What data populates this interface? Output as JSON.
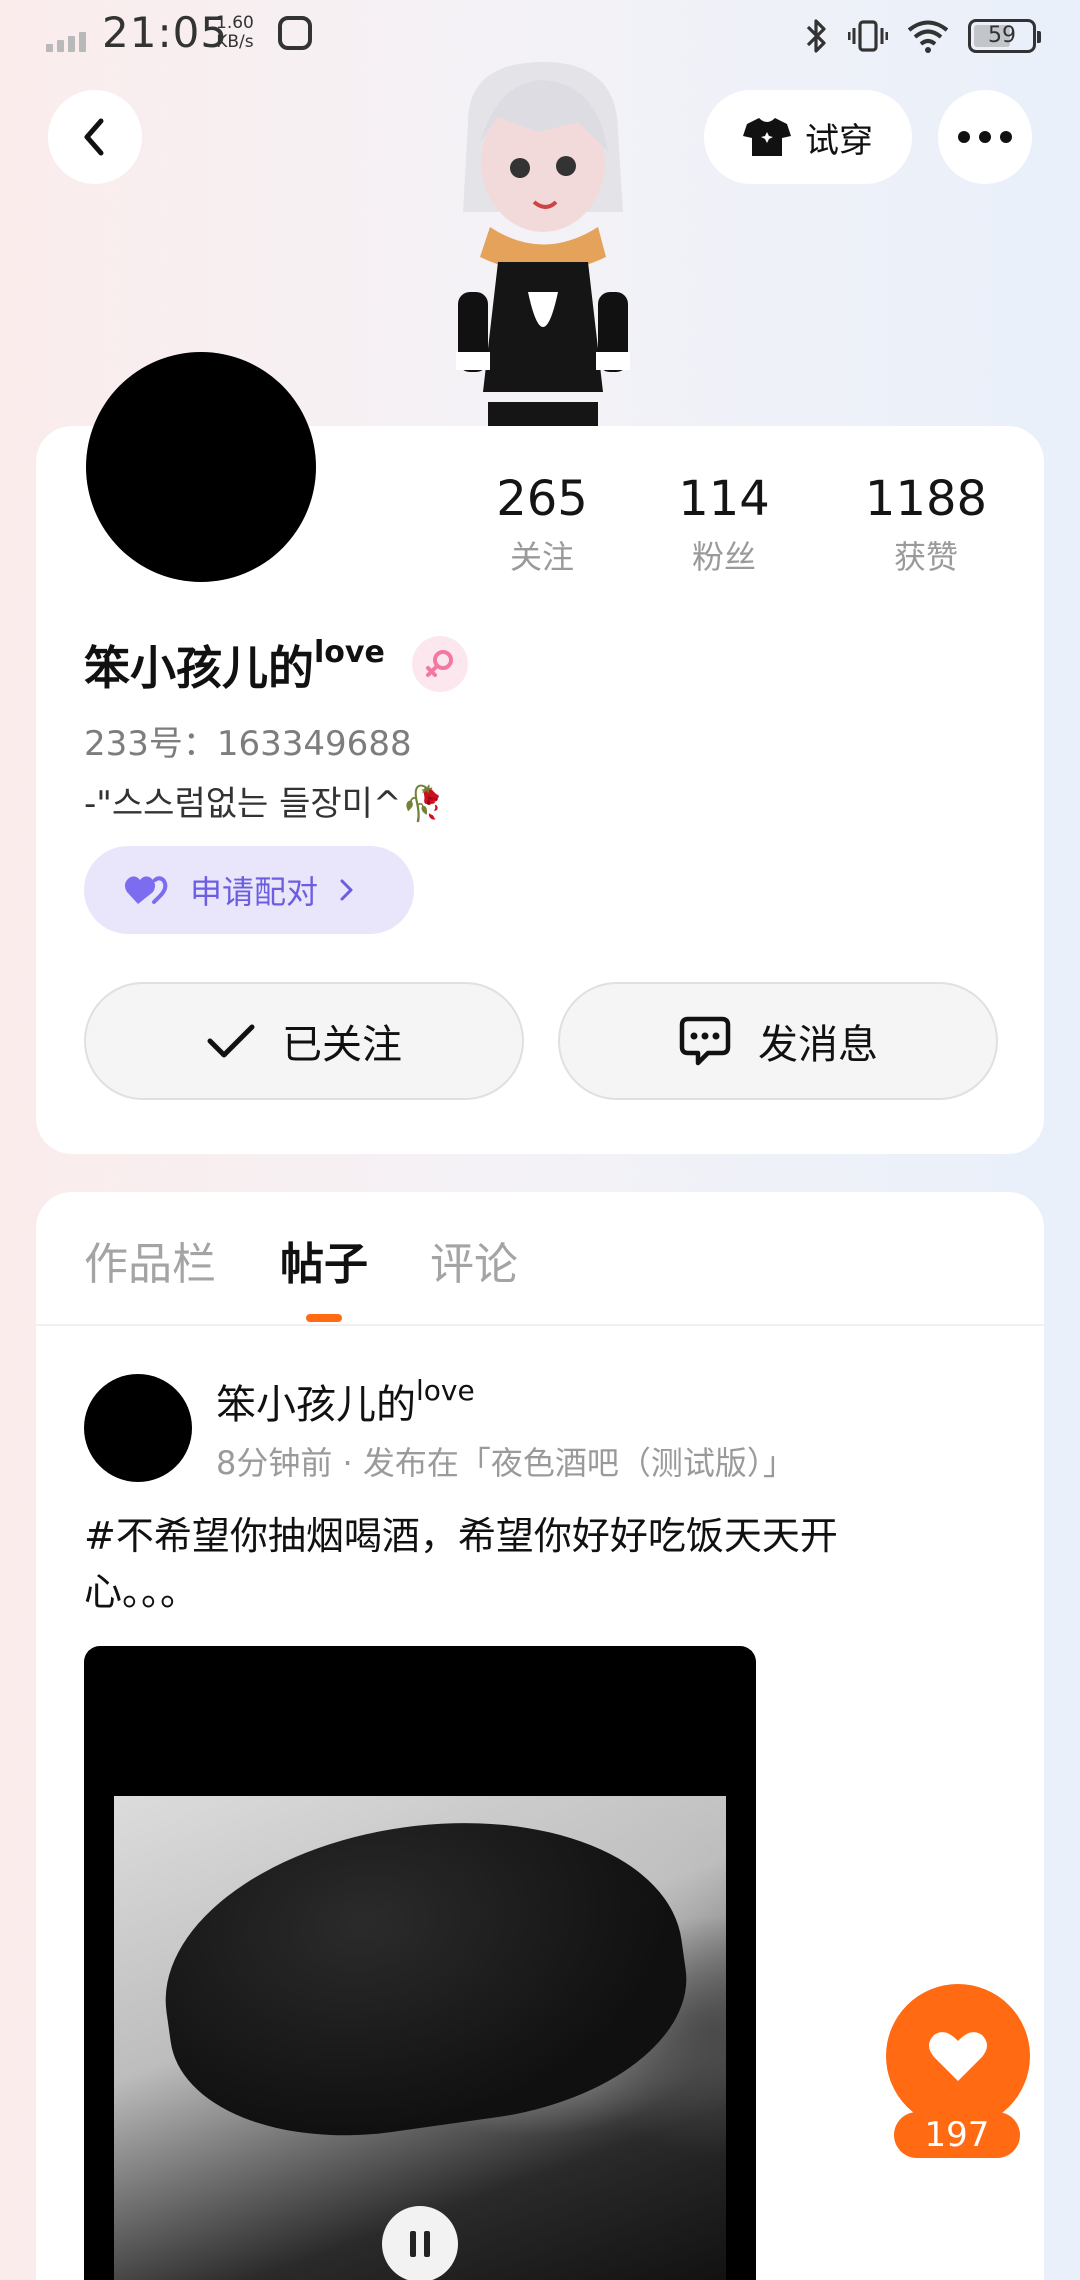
{
  "status_bar": {
    "time": "21:05",
    "net_speed_value": "1.60",
    "net_speed_unit": "KB/s",
    "battery": "59",
    "icons": [
      "signal-icon",
      "camera-app-icon",
      "bluetooth-icon",
      "vibrate-icon",
      "wifi-icon",
      "battery-icon"
    ]
  },
  "top_bar": {
    "try_on_label": "试穿"
  },
  "profile": {
    "stats": [
      {
        "value": "265",
        "label": "关注"
      },
      {
        "value": "114",
        "label": "粉丝"
      },
      {
        "value": "1188",
        "label": "获赞"
      }
    ],
    "name": "笨小孩儿的",
    "name_sup": "love",
    "gender": "female",
    "uid": "233号：163349688",
    "bio": "-\"스스럼없는 들장미^",
    "bio_emoji": "🥀",
    "pair_label": "申请配对",
    "follow_label": "已关注",
    "message_label": "发消息"
  },
  "tabs": [
    {
      "label": "作品栏",
      "active": false
    },
    {
      "label": "帖子",
      "active": true
    },
    {
      "label": "评论",
      "active": false
    }
  ],
  "post": {
    "author": "笨小孩儿的",
    "author_sup": "love",
    "meta": "8分钟前 · 发布在「夜色酒吧（测试版）」",
    "text": "#不希望你抽烟喝酒，希望你好好吃饭天天开心。。。",
    "like_count": "197"
  },
  "colors": {
    "accent": "#ff6a13",
    "pair_bg": "#e9e6fb",
    "pair_text": "#6b5ee0"
  }
}
